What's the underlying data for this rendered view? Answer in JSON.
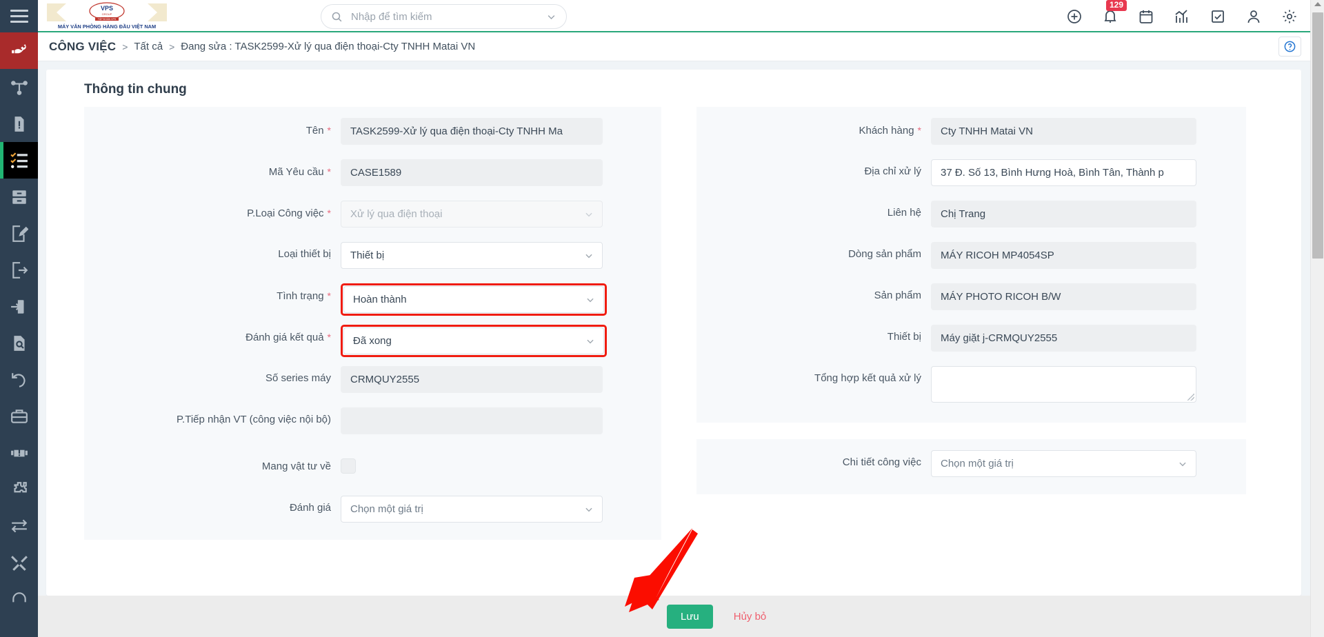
{
  "brand": {
    "logo_text_top": "VPS",
    "logo_subtext": "TẬP ĐOÀN VPS",
    "logo_tagline": "MÁY VĂN PHÒNG HÀNG ĐẦU VIỆT NAM"
  },
  "search": {
    "placeholder": "Nhập để tìm kiếm",
    "value": ""
  },
  "topbar": {
    "icons": [
      {
        "name": "plus-circle-icon"
      },
      {
        "name": "bell-icon",
        "badge": "129"
      },
      {
        "name": "calendar-icon"
      },
      {
        "name": "chart-icon"
      },
      {
        "name": "checkbox-icon"
      },
      {
        "name": "user-icon"
      },
      {
        "name": "gear-icon"
      }
    ],
    "notification_count": "129"
  },
  "sidebar": {
    "items": [
      {
        "name": "sidebar-item-service",
        "icon": "hand-wrench-icon",
        "state": "brand"
      },
      {
        "name": "sidebar-item-network",
        "icon": "sitemap-icon",
        "state": "normal"
      },
      {
        "name": "sidebar-item-report-issue",
        "icon": "document-alert-icon",
        "state": "normal"
      },
      {
        "name": "sidebar-item-tasks",
        "icon": "checklist-icon",
        "state": "active"
      },
      {
        "name": "sidebar-item-archive",
        "icon": "file-cabinet-icon",
        "state": "normal"
      },
      {
        "name": "sidebar-item-edit-doc",
        "icon": "document-edit-icon",
        "state": "normal"
      },
      {
        "name": "sidebar-item-export",
        "icon": "document-out-icon",
        "state": "normal"
      },
      {
        "name": "sidebar-item-import",
        "icon": "document-in-icon",
        "state": "normal"
      },
      {
        "name": "sidebar-item-search-doc",
        "icon": "document-search-icon",
        "state": "normal"
      },
      {
        "name": "sidebar-item-history",
        "icon": "undo-icon",
        "state": "normal"
      },
      {
        "name": "sidebar-item-toolbox",
        "icon": "briefcase-icon",
        "state": "normal"
      },
      {
        "name": "sidebar-item-warranty",
        "icon": "hand-alert-icon",
        "state": "normal"
      },
      {
        "name": "sidebar-item-parts",
        "icon": "puzzle-icon",
        "state": "normal"
      },
      {
        "name": "sidebar-item-transfer",
        "icon": "exchange-icon",
        "state": "normal"
      },
      {
        "name": "sidebar-item-tools",
        "icon": "tools-icon",
        "state": "normal"
      },
      {
        "name": "sidebar-item-support",
        "icon": "headset-icon",
        "state": "normal"
      }
    ]
  },
  "breadcrumb": {
    "title": "CÔNG VIỆC",
    "separator": ">",
    "level2": "Tất cả",
    "level3": "Đang sửa : TASK2599-Xử lý qua điện thoại-Cty TNHH Matai VN"
  },
  "help": {
    "icon": "question-circle-icon"
  },
  "page": {
    "section_title": "Thông tin chung"
  },
  "left_fields": [
    {
      "label": "Tên",
      "required": true,
      "type": "text",
      "value": "TASK2599-Xử lý qua điện thoại-Cty TNHH Ma",
      "style": "filled"
    },
    {
      "label": "Mã Yêu cầu",
      "required": true,
      "type": "text",
      "value": "CASE1589",
      "style": "filled"
    },
    {
      "label": "P.Loại Công việc",
      "required": true,
      "type": "select",
      "value": "Xử lý qua điện thoại",
      "style": "disabled"
    },
    {
      "label": "Loại thiết bị",
      "required": false,
      "type": "select",
      "value": "Thiết bị",
      "style": "white"
    },
    {
      "label": "Tình trạng",
      "required": true,
      "type": "select",
      "value": "Hoàn thành",
      "style": "white",
      "highlighted": true
    },
    {
      "label": "Đánh giá kết quả",
      "required": true,
      "type": "select",
      "value": "Đã xong",
      "style": "white",
      "highlighted": true
    },
    {
      "label": "Số series máy",
      "required": false,
      "type": "text",
      "value": "CRMQUY2555",
      "style": "filled"
    },
    {
      "label": "P.Tiếp nhận VT (công việc nội bộ)",
      "required": false,
      "type": "text",
      "value": "",
      "style": "filled"
    },
    {
      "label": "Mang vật tư về",
      "required": false,
      "type": "checkbox",
      "value": "",
      "checked": false
    },
    {
      "label": "Đánh giá",
      "required": false,
      "type": "select",
      "value": "Chọn một giá trị",
      "style": "white",
      "placeholder": true
    }
  ],
  "right_fields": [
    {
      "label": "Khách hàng",
      "required": true,
      "type": "text",
      "value": "Cty TNHH Matai VN",
      "style": "filled"
    },
    {
      "label": "Địa chỉ xử lý",
      "required": false,
      "type": "text",
      "value": "37 Đ. Số 13, Bình Hưng Hoà, Bình Tân, Thành p",
      "style": "white"
    },
    {
      "label": "Liên hệ",
      "required": false,
      "type": "text",
      "value": "Chị Trang",
      "style": "filled"
    },
    {
      "label": "Dòng sản phẩm",
      "required": false,
      "type": "text",
      "value": "MÁY  RICOH MP4054SP",
      "style": "filled"
    },
    {
      "label": "Sản phẩm",
      "required": false,
      "type": "text",
      "value": "MÁY PHOTO RICOH B/W",
      "style": "filled"
    },
    {
      "label": "Thiết bị",
      "required": false,
      "type": "text",
      "value": "Máy giặt j-CRMQUY2555",
      "style": "filled"
    },
    {
      "label": "Tổng hợp kết quả xử lý",
      "required": false,
      "type": "textarea",
      "value": ""
    }
  ],
  "right_fields_secondary": [
    {
      "label": "Chi tiết công việc",
      "required": false,
      "type": "select",
      "value": "Chọn một giá trị",
      "style": "white",
      "placeholder": true
    }
  ],
  "footer": {
    "save_label": "Lưu",
    "cancel_label": "Hủy bỏ"
  },
  "colors": {
    "accent_green": "#26b07f",
    "brand_red": "#a92b2b",
    "sidebar_bg": "#2e4052",
    "danger": "#ef5f6e",
    "highlight": "#f01c10",
    "badge": "#e8384f"
  }
}
